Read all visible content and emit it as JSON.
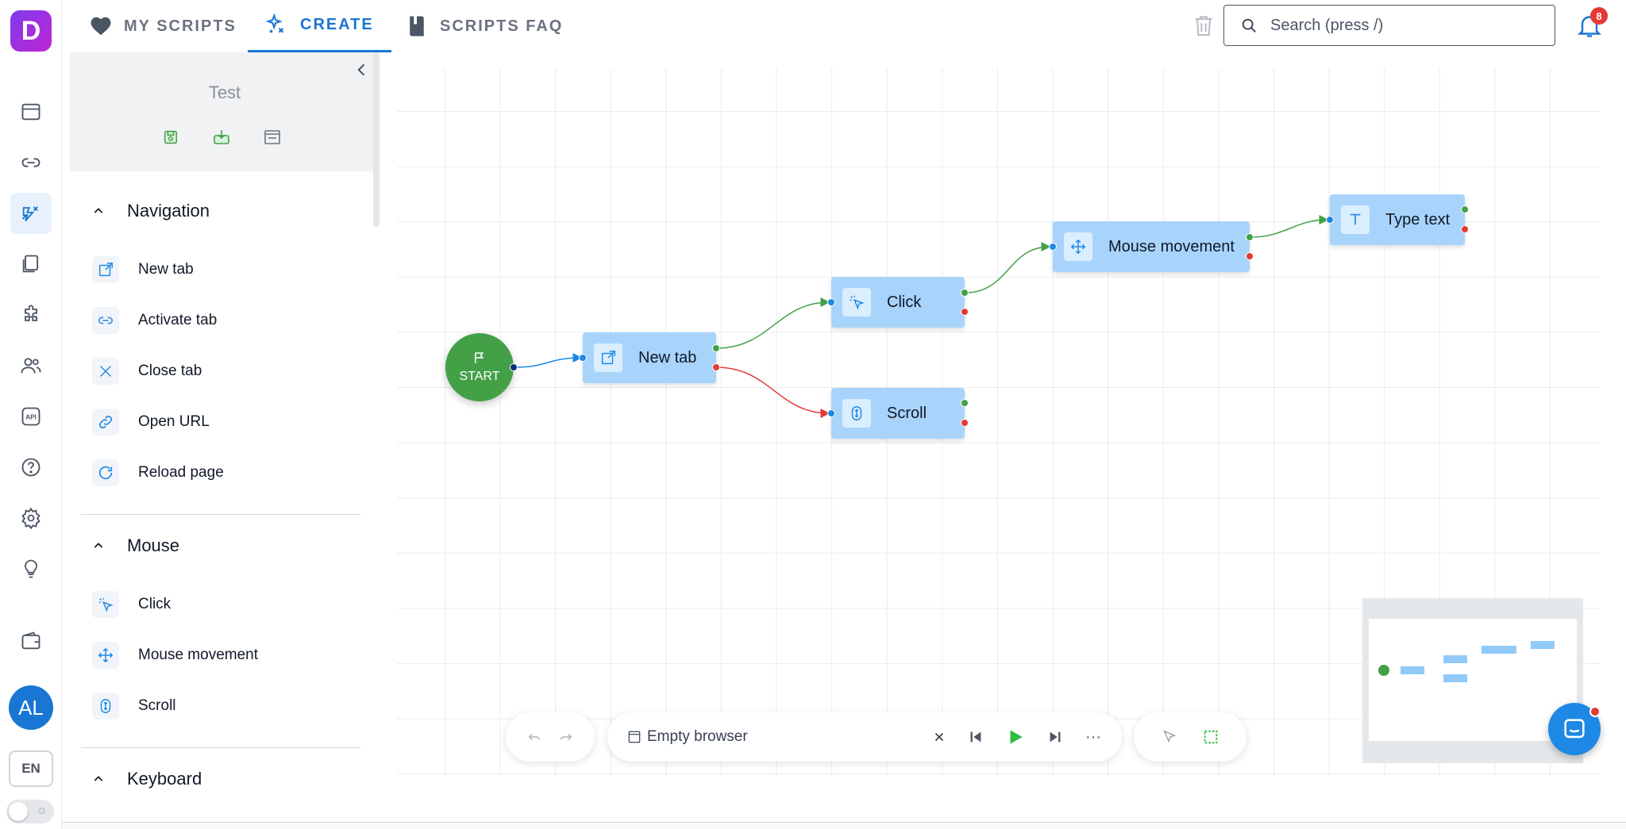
{
  "app": {
    "logo_letter": "D",
    "brand_color": "#8b2fd6"
  },
  "tabs": [
    {
      "label": "MY SCRIPTS",
      "icon": "heart-icon"
    },
    {
      "label": "CREATE",
      "icon": "sparkles-icon"
    },
    {
      "label": "SCRIPTS FAQ",
      "icon": "book-icon"
    }
  ],
  "search": {
    "placeholder": "Search (press /)"
  },
  "notifications": {
    "count": "8"
  },
  "rail": {
    "items": [
      "browser-window-icon",
      "link-icon",
      "script-builder-icon",
      "bookmarks-icon",
      "extensions-icon",
      "team-icon",
      "api-icon",
      "help-icon",
      "settings-icon",
      "lightbulb-icon",
      "wallet-icon"
    ],
    "api_label": "API",
    "avatar": "AL",
    "lang": "EN"
  },
  "panel": {
    "script_name": "Test",
    "sections": [
      {
        "title": "Navigation",
        "items": [
          "New tab",
          "Activate tab",
          "Close tab",
          "Open URL",
          "Reload page"
        ]
      },
      {
        "title": "Mouse",
        "items": [
          "Click",
          "Mouse movement",
          "Scroll"
        ]
      },
      {
        "title": "Keyboard"
      }
    ]
  },
  "flow": {
    "start": "START",
    "nodes": {
      "new_tab": "New tab",
      "click": "Click",
      "scroll": "Scroll",
      "mouse_movement": "Mouse movement",
      "type_text": "Type text"
    }
  },
  "toolbar": {
    "browser": "Empty browser",
    "more": "···"
  },
  "colors": {
    "accent": "#1976d2",
    "node_bg": "#a8d4fb",
    "start_green": "#43a047",
    "success_edge": "#43a047",
    "fail_edge": "#e53935"
  }
}
